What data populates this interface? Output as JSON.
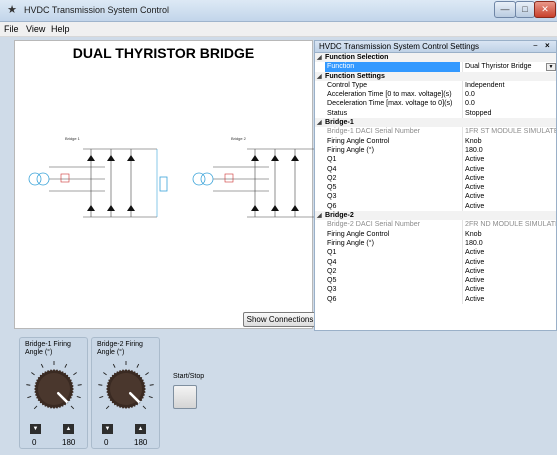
{
  "window": {
    "title": "HVDC Transmission System Control",
    "icon": "tower-icon"
  },
  "menu": [
    {
      "label": "File"
    },
    {
      "label": "View"
    },
    {
      "label": "Help"
    }
  ],
  "diagram": {
    "title": "DUAL THYRISTOR BRIDGE",
    "bridge1_label": "Bridge 1",
    "bridge2_label": "Bridge 2",
    "show_connections": "Show Connections"
  },
  "settings": {
    "title": "HVDC Transmission System Control Settings",
    "pin_glyph": "ɰ",
    "close_glyph": "×",
    "rows": [
      {
        "type": "category",
        "label": "Function Selection"
      },
      {
        "type": "property",
        "name": "Function",
        "value": "Dual Thyristor Bridge",
        "selected": true
      },
      {
        "type": "category",
        "label": "Function Settings"
      },
      {
        "type": "property",
        "name": "Control Type",
        "value": "Independent"
      },
      {
        "type": "property",
        "name": "Acceleration Time [0 to max. voltage](s)",
        "value": "0.0"
      },
      {
        "type": "property",
        "name": "Deceleration Time [max. voltage to 0](s)",
        "value": "0.0"
      },
      {
        "type": "property",
        "name": "Status",
        "value": "Stopped"
      },
      {
        "type": "category",
        "label": "Bridge-1"
      },
      {
        "type": "property",
        "name": "Bridge-1 DACI Serial Number",
        "value": "1FR ST MODULE SIMULATE",
        "gray": true
      },
      {
        "type": "property",
        "name": "Firing Angle Control",
        "value": "Knob"
      },
      {
        "type": "property",
        "name": "Firing Angle (°)",
        "value": "180.0"
      },
      {
        "type": "property",
        "name": "Q1",
        "value": "Active"
      },
      {
        "type": "property",
        "name": "Q4",
        "value": "Active"
      },
      {
        "type": "property",
        "name": "Q2",
        "value": "Active"
      },
      {
        "type": "property",
        "name": "Q5",
        "value": "Active"
      },
      {
        "type": "property",
        "name": "Q3",
        "value": "Active"
      },
      {
        "type": "property",
        "name": "Q6",
        "value": "Active"
      },
      {
        "type": "category",
        "label": "Bridge-2"
      },
      {
        "type": "property",
        "name": "Bridge-2 DACI Serial Number",
        "value": "2FR ND MODULE SIMULATE",
        "gray": true
      },
      {
        "type": "property",
        "name": "Firing Angle Control",
        "value": "Knob"
      },
      {
        "type": "property",
        "name": "Firing Angle (°)",
        "value": "180.0"
      },
      {
        "type": "property",
        "name": "Q1",
        "value": "Active"
      },
      {
        "type": "property",
        "name": "Q4",
        "value": "Active"
      },
      {
        "type": "property",
        "name": "Q2",
        "value": "Active"
      },
      {
        "type": "property",
        "name": "Q5",
        "value": "Active"
      },
      {
        "type": "property",
        "name": "Q3",
        "value": "Active"
      },
      {
        "type": "property",
        "name": "Q6",
        "value": "Active"
      }
    ]
  },
  "knobs": [
    {
      "label": "Bridge-1 Firing\nAngle (°)",
      "min": "0",
      "max": "180",
      "value": 180
    },
    {
      "label": "Bridge-2 Firing\nAngle (°)",
      "min": "0",
      "max": "180",
      "value": 180
    }
  ],
  "start_stop": {
    "label": "Start/Stop"
  },
  "colors": {
    "wire": "#3aa3d9",
    "accent_selected": "#3399ff",
    "background": "#cfdbe8"
  }
}
